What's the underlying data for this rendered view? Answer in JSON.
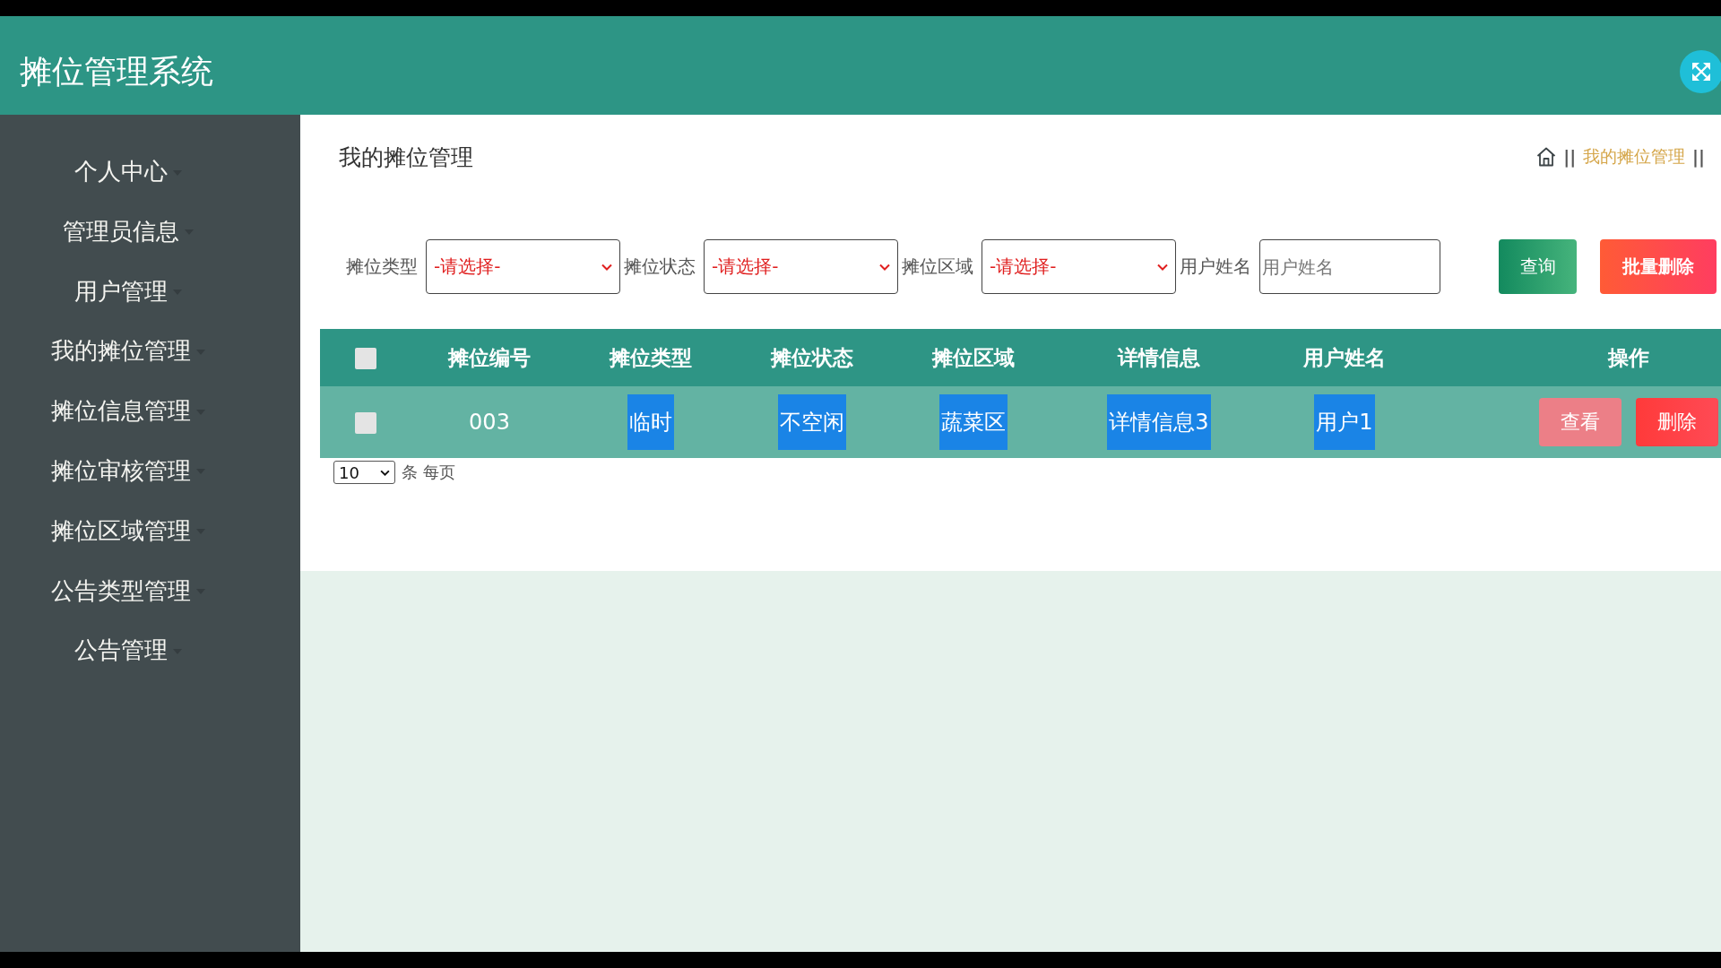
{
  "header": {
    "title": "摊位管理系统"
  },
  "sidebar": {
    "items": [
      {
        "label": "个人中心"
      },
      {
        "label": "管理员信息"
      },
      {
        "label": "用户管理"
      },
      {
        "label": "我的摊位管理"
      },
      {
        "label": "摊位信息管理"
      },
      {
        "label": "摊位审核管理"
      },
      {
        "label": "摊位区域管理"
      },
      {
        "label": "公告类型管理"
      },
      {
        "label": "公告管理"
      }
    ]
  },
  "page": {
    "title": "我的摊位管理",
    "breadcrumb": [
      {
        "kind": "home"
      },
      {
        "kind": "separator",
        "text": "||"
      },
      {
        "kind": "link",
        "text": "我的摊位管理"
      },
      {
        "kind": "separator",
        "text": "||"
      }
    ]
  },
  "filters": [
    {
      "kind": "select",
      "label": "摊位类型",
      "value": "-请选择-"
    },
    {
      "kind": "select",
      "label": "摊位状态",
      "value": "-请选择-"
    },
    {
      "kind": "select",
      "label": "摊位区域",
      "value": "-请选择-"
    },
    {
      "kind": "input",
      "label": "用户姓名",
      "placeholder": "用户姓名"
    }
  ],
  "actions": [
    {
      "kind": "search",
      "label": "查询"
    },
    {
      "kind": "batch-delete",
      "label": "批量删除"
    }
  ],
  "table": {
    "select_all": {
      "checked": false
    },
    "columns": [
      {
        "label": "摊位编号"
      },
      {
        "label": "摊位类型"
      },
      {
        "label": "摊位状态"
      },
      {
        "label": "摊位区域"
      },
      {
        "label": "详情信息"
      },
      {
        "label": "用户姓名"
      },
      {
        "label": "操作"
      }
    ],
    "rows": [
      {
        "checked": false,
        "cells": [
          {
            "text": "003",
            "highlighted": false
          },
          {
            "text": "临时",
            "highlighted": true
          },
          {
            "text": "不空闲",
            "highlighted": true
          },
          {
            "text": "蔬菜区",
            "highlighted": true
          },
          {
            "text": "详情信息3",
            "highlighted": true
          },
          {
            "text": "用户1",
            "highlighted": true
          }
        ],
        "actions": [
          {
            "kind": "view",
            "label": "查看"
          },
          {
            "kind": "delete",
            "label": "删除"
          }
        ]
      }
    ]
  },
  "pagination": {
    "page_size": "10",
    "label": "条 每页"
  }
}
